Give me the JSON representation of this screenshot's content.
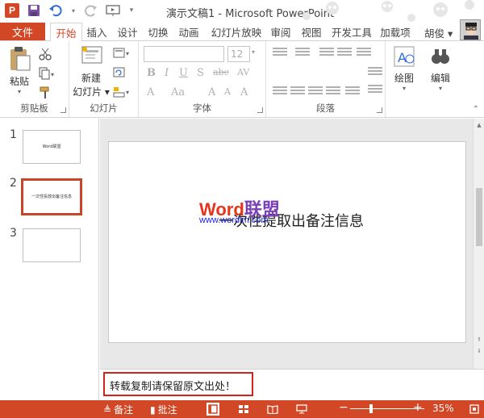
{
  "window": {
    "title": "演示文稿1 - Microsoft PowerPoint"
  },
  "tabs": {
    "file": "文件",
    "items": [
      "开始",
      "插入",
      "设计",
      "切换",
      "动画",
      "幻灯片放映",
      "审阅",
      "视图",
      "开发工具",
      "加载项"
    ],
    "active": "开始",
    "user": "胡俊 ▾"
  },
  "ribbon": {
    "clipboard": {
      "paste": "粘贴",
      "label": "剪贴板"
    },
    "slides": {
      "new_slide_1": "新建",
      "new_slide_2": "幻灯片 ▾",
      "label": "幻灯片"
    },
    "font": {
      "label": "字体",
      "size": "12"
    },
    "paragraph": {
      "label": "段落"
    },
    "drawing": {
      "label": "绘图"
    },
    "editing": {
      "label": "编辑"
    }
  },
  "thumbnails": [
    {
      "num": "1",
      "text": "Word联盟"
    },
    {
      "num": "2",
      "text": "一次性投放出备注信息"
    },
    {
      "num": "3",
      "text": ""
    }
  ],
  "slide": {
    "text": "一次性提取出备注信息",
    "watermark_word": "Word",
    "watermark_cn": "联盟",
    "watermark_url": "www.wordlm.com"
  },
  "notes": {
    "text": "转载复制请保留原文出处！"
  },
  "status": {
    "notes": "备注",
    "comments": "批注",
    "zoom": "35%"
  },
  "colors": {
    "accent": "#d24726",
    "highlight_border": "#d3241b"
  }
}
